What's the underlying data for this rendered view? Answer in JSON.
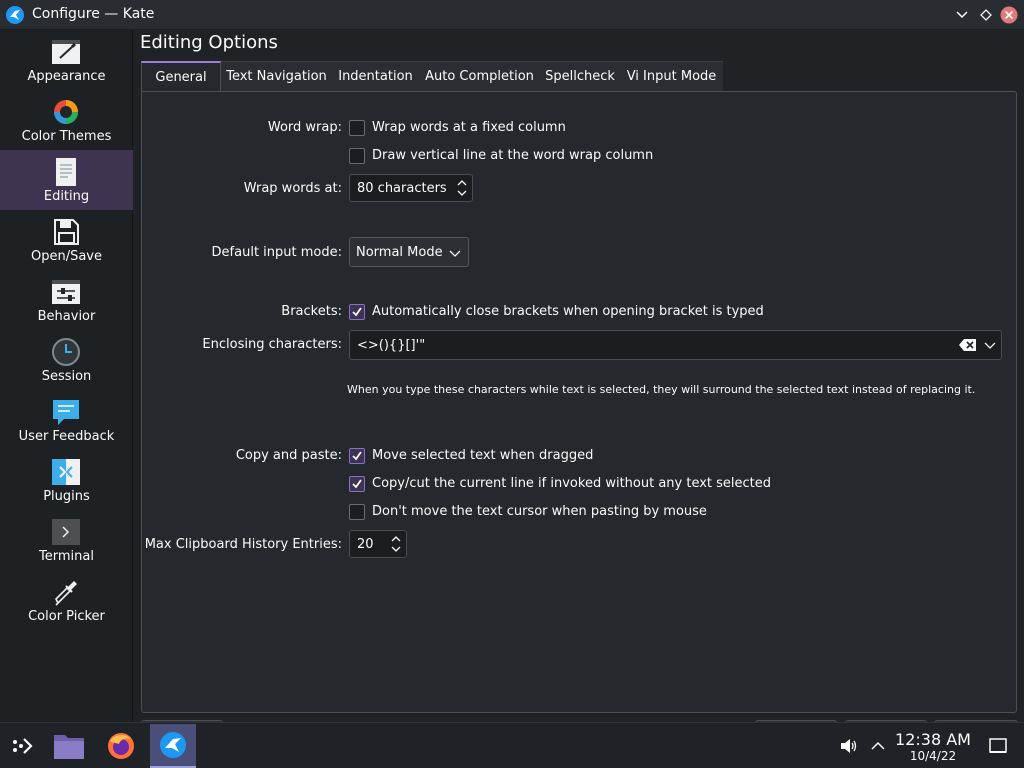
{
  "window": {
    "title": "Configure — Kate"
  },
  "sidebar": {
    "items": [
      {
        "label": "Appearance",
        "icon": "appearance-icon"
      },
      {
        "label": "Color Themes",
        "icon": "color-themes-icon"
      },
      {
        "label": "Editing",
        "icon": "editing-icon",
        "active": true
      },
      {
        "label": "Open/Save",
        "icon": "save-icon"
      },
      {
        "label": "Behavior",
        "icon": "behavior-icon"
      },
      {
        "label": "Session",
        "icon": "session-clock-icon"
      },
      {
        "label": "User Feedback",
        "icon": "feedback-icon"
      },
      {
        "label": "Plugins",
        "icon": "plugins-icon"
      },
      {
        "label": "Terminal",
        "icon": "terminal-icon"
      },
      {
        "label": "Color Picker",
        "icon": "color-picker-icon"
      }
    ]
  },
  "main": {
    "title": "Editing Options",
    "tabs": [
      {
        "label": "General",
        "active": true
      },
      {
        "label": "Text Navigation"
      },
      {
        "label": "Indentation"
      },
      {
        "label": "Auto Completion"
      },
      {
        "label": "Spellcheck"
      },
      {
        "label": "Vi Input Mode"
      }
    ],
    "general": {
      "word_wrap_label": "Word wrap:",
      "wrap_fixed_label": "Wrap words at a fixed column",
      "wrap_fixed_checked": false,
      "vertical_line_label": "Draw vertical line at the word wrap column",
      "vertical_line_checked": false,
      "wrap_at_label": "Wrap words at:",
      "wrap_at_value": "80 characters",
      "input_mode_label": "Default input mode:",
      "input_mode_value": "Normal Mode",
      "brackets_label": "Brackets:",
      "auto_close_label": "Automatically close brackets when opening bracket is typed",
      "auto_close_checked": true,
      "enclosing_label": "Enclosing characters:",
      "enclosing_value": "<>(){}[]'\"",
      "enclosing_hint": "When you type these characters while text is selected, they will surround the selected text instead of replacing it.",
      "copy_paste_label": "Copy and paste:",
      "move_selected_label": "Move selected text when dragged",
      "move_selected_checked": true,
      "copy_cut_label": "Copy/cut the current line if invoked without any text selected",
      "copy_cut_checked": true,
      "dont_move_cursor_label": "Don't move the text cursor when pasting by mouse",
      "dont_move_cursor_checked": false,
      "clipboard_history_label": "Max Clipboard History Entries:",
      "clipboard_history_value": "20"
    }
  },
  "taskbar": {
    "apps": [
      "application-launcher-icon",
      "file-manager-icon",
      "firefox-icon",
      "kate-icon"
    ],
    "active_app": "kate-icon",
    "time": "12:38 AM",
    "date": "10/4/22"
  },
  "colors": {
    "accent": "#9c7dd9",
    "selection": "#3e3350",
    "background": "#202326"
  }
}
